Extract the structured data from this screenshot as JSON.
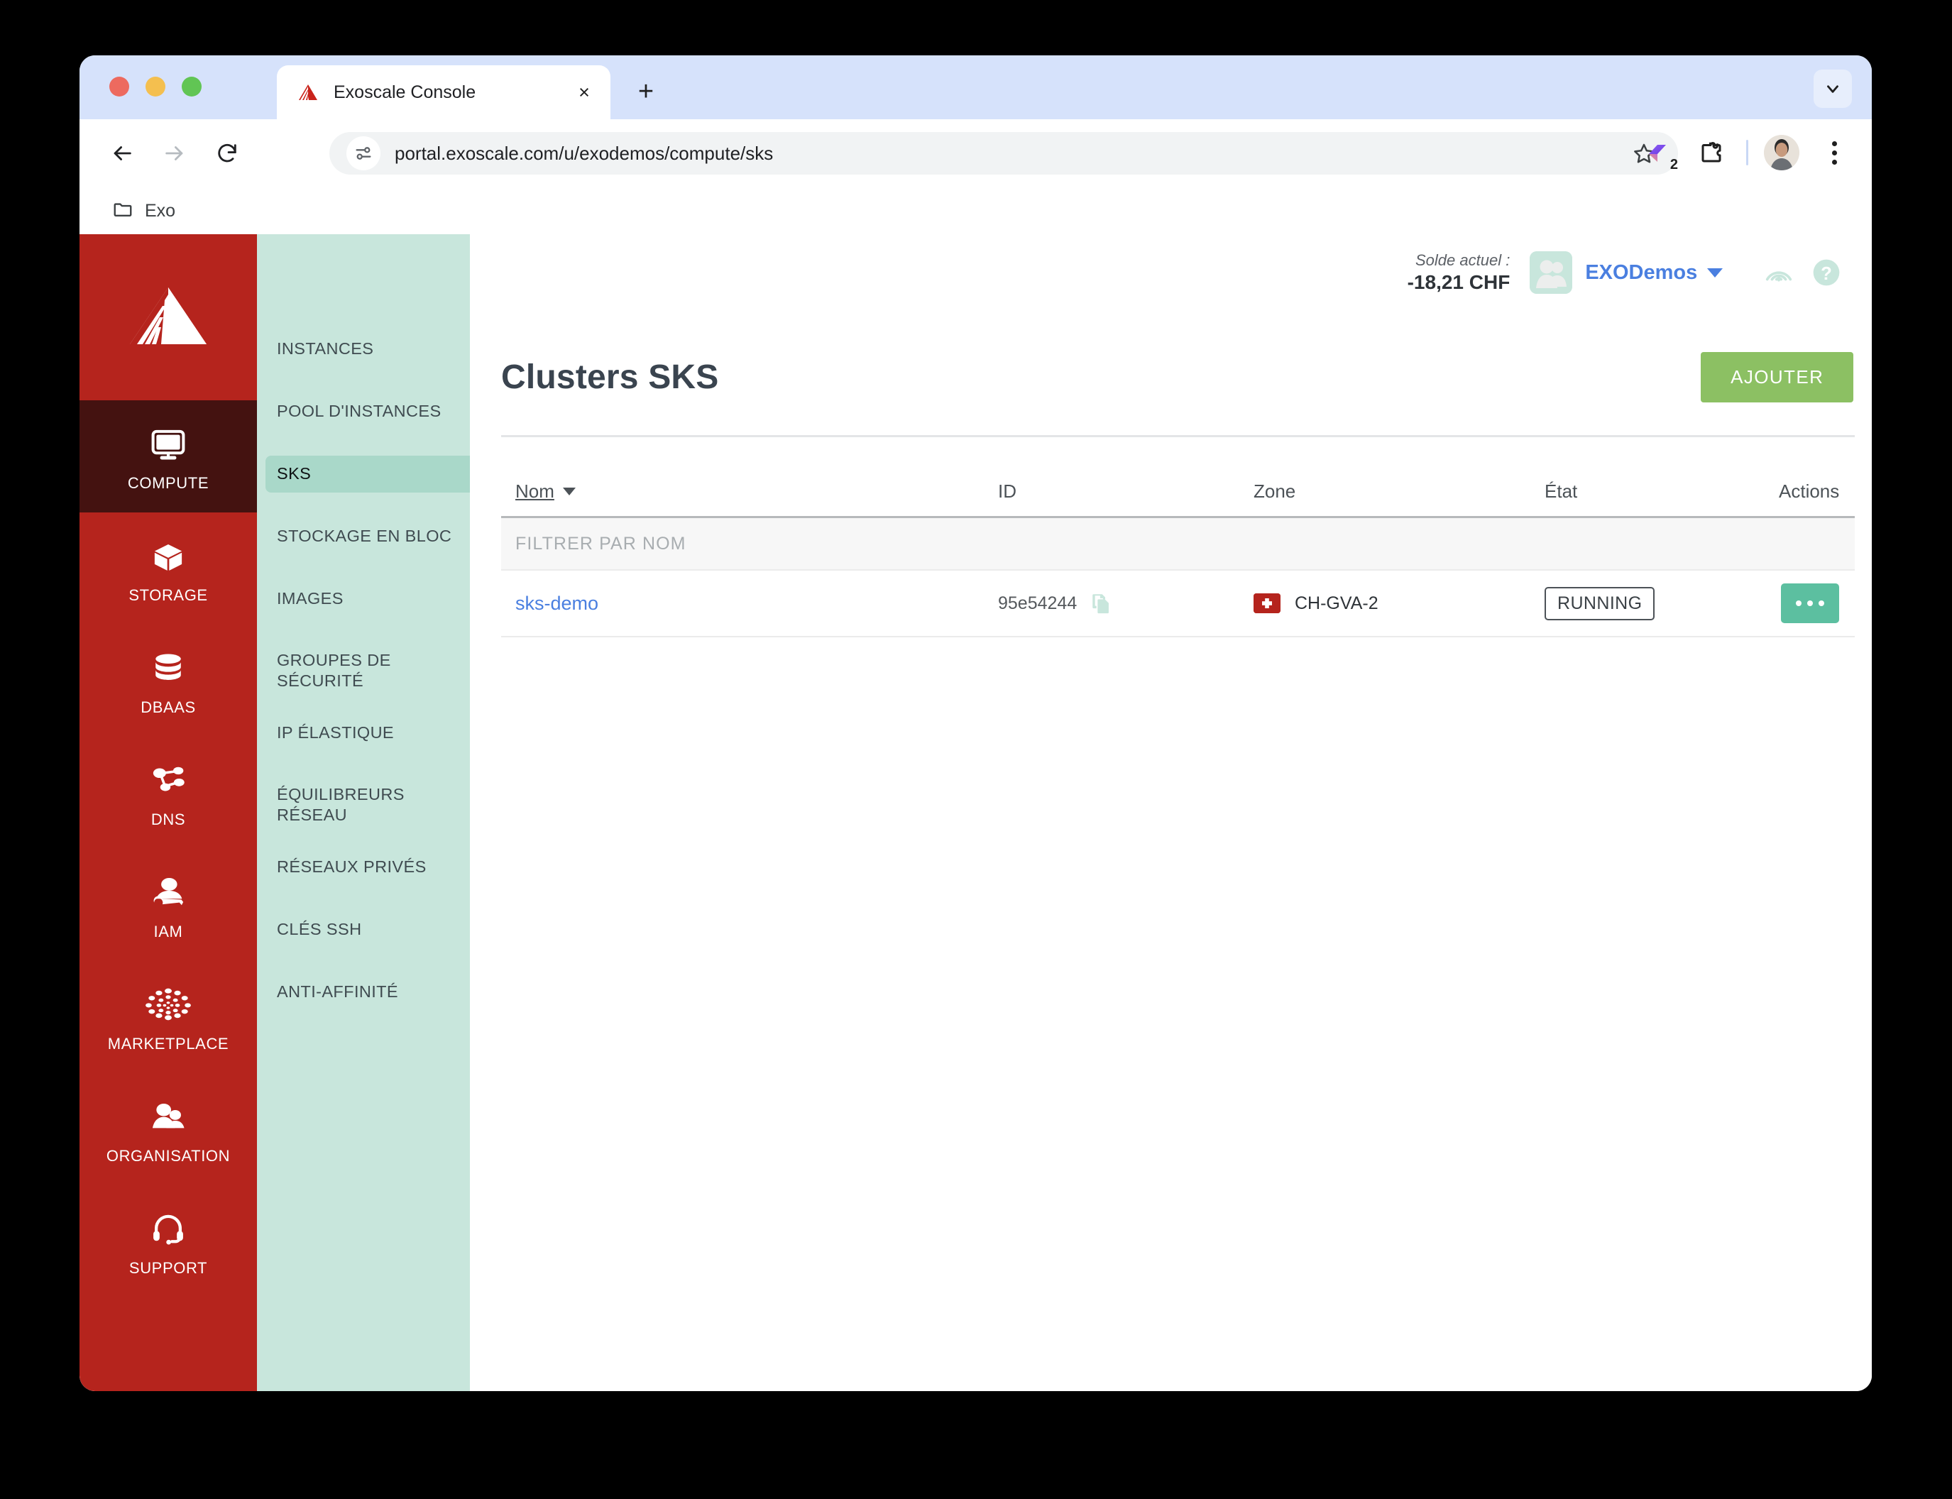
{
  "browser": {
    "tab": {
      "title": "Exoscale Console",
      "favicon": "exoscale-logo-icon",
      "close": "×"
    },
    "new_tab": "+",
    "url": "portal.exoscale.com/u/exodemos/compute/sks",
    "extension_badge_count": "2",
    "bookmarks": [
      {
        "label": "Exo",
        "icon": "folder-icon"
      }
    ]
  },
  "header": {
    "balance_label": "Solde actuel :",
    "balance_value": "-18,21 CHF",
    "org_name": "EXODemos"
  },
  "sidebar": {
    "brand": "exoscale-logo",
    "items": [
      {
        "label": "COMPUTE",
        "icon": "monitor-icon",
        "active": true
      },
      {
        "label": "STORAGE",
        "icon": "box-icon",
        "active": false
      },
      {
        "label": "DBAAS",
        "icon": "database-icon",
        "active": false
      },
      {
        "label": "DNS",
        "icon": "network-nodes-icon",
        "active": false
      },
      {
        "label": "IAM",
        "icon": "user-key-icon",
        "active": false
      },
      {
        "label": "MARKETPLACE",
        "icon": "dots-swirl-icon",
        "active": false
      },
      {
        "label": "ORGANISATION",
        "icon": "users-icon",
        "active": false
      },
      {
        "label": "SUPPORT",
        "icon": "headset-icon",
        "active": false
      }
    ]
  },
  "submenu": {
    "items": [
      {
        "label": "INSTANCES",
        "active": false
      },
      {
        "label": "POOL D'INSTANCES",
        "active": false
      },
      {
        "label": "SKS",
        "active": true
      },
      {
        "label": "STOCKAGE EN BLOC",
        "active": false
      },
      {
        "label": "IMAGES",
        "active": false
      },
      {
        "label": "GROUPES DE SÉCURITÉ",
        "active": false
      },
      {
        "label": "IP ÉLASTIQUE",
        "active": false
      },
      {
        "label": "ÉQUILIBREURS RÉSEAU",
        "active": false
      },
      {
        "label": "RÉSEAUX PRIVÉS",
        "active": false
      },
      {
        "label": "CLÉS SSH",
        "active": false
      },
      {
        "label": "ANTI-AFFINITÉ",
        "active": false
      }
    ]
  },
  "main": {
    "title": "Clusters SKS",
    "add_button": "AJOUTER",
    "table": {
      "columns": {
        "name": "Nom",
        "id": "ID",
        "zone": "Zone",
        "etat": "État",
        "actions": "Actions"
      },
      "filter_placeholder": "FILTRER PAR NOM",
      "filter_value": "",
      "rows": [
        {
          "name": "sks-demo",
          "id": "95e54244",
          "zone": "CH-GVA-2",
          "zone_flag": "swiss-flag-icon",
          "etat": "RUNNING"
        }
      ]
    }
  },
  "colors": {
    "brand_red": "#b5241d",
    "sidebar_active": "#441210",
    "submenu_bg": "#c8e6dc",
    "submenu_active": "#a9d8c9",
    "add_button_green": "#8cc063",
    "action_teal": "#5cbfa0",
    "link_blue": "#4a7fe0"
  }
}
